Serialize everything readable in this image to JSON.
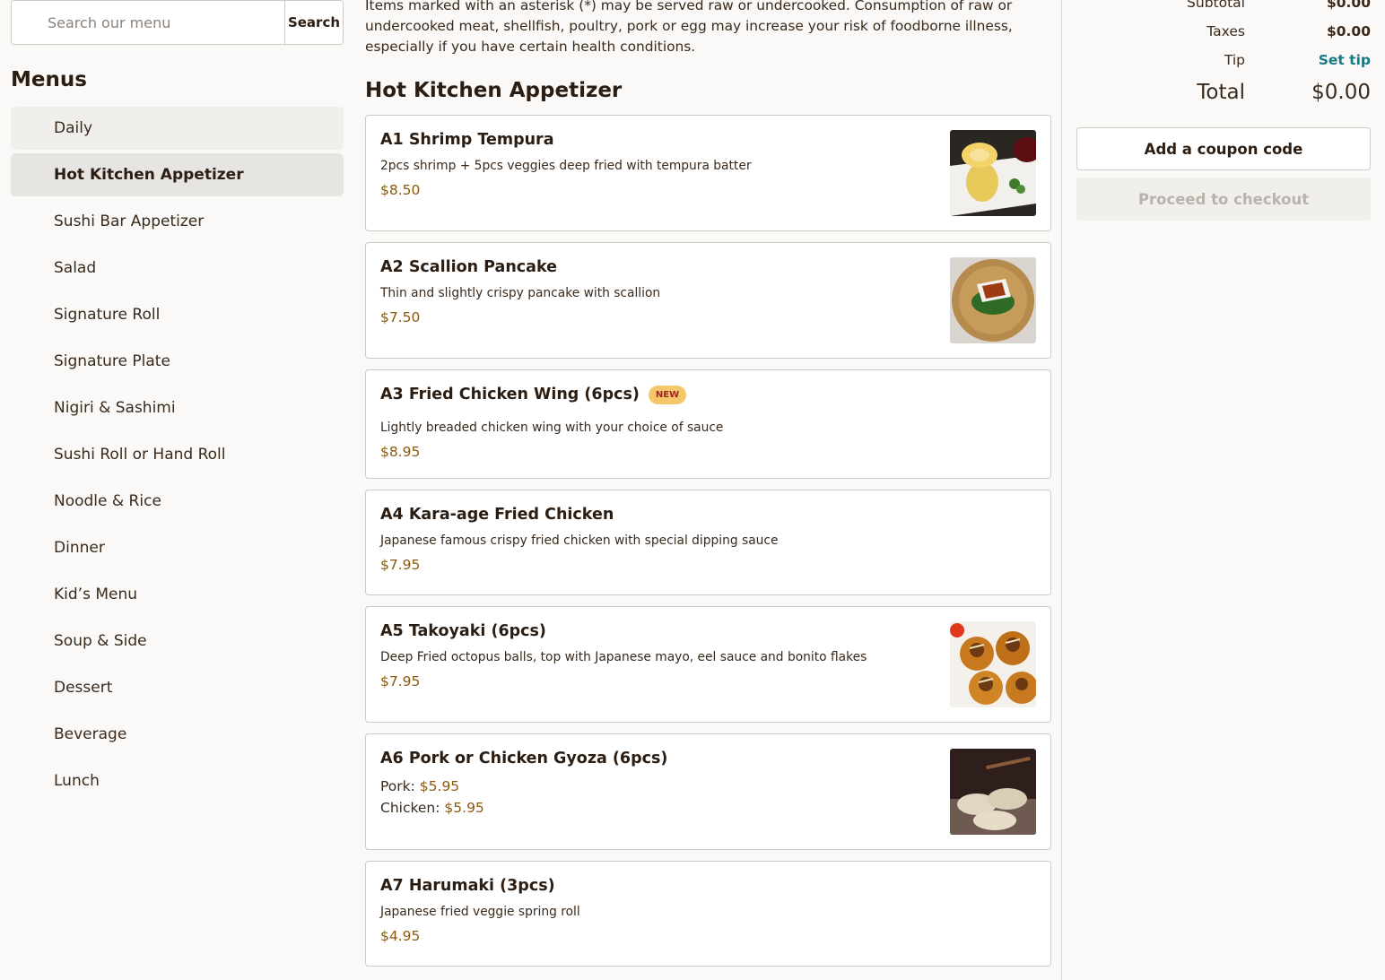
{
  "search": {
    "placeholder": "Search our menu",
    "button_label": "Search"
  },
  "menus": {
    "heading": "Menus",
    "items": [
      {
        "label": "Daily"
      },
      {
        "label": "Hot Kitchen Appetizer"
      },
      {
        "label": "Sushi Bar Appetizer"
      },
      {
        "label": "Salad"
      },
      {
        "label": "Signature Roll"
      },
      {
        "label": "Signature Plate"
      },
      {
        "label": "Nigiri & Sashimi"
      },
      {
        "label": "Sushi Roll or Hand Roll"
      },
      {
        "label": "Noodle & Rice"
      },
      {
        "label": "Dinner"
      },
      {
        "label": "Kid’s Menu"
      },
      {
        "label": "Soup & Side"
      },
      {
        "label": "Dessert"
      },
      {
        "label": "Beverage"
      },
      {
        "label": "Lunch"
      }
    ],
    "active": "Hot Kitchen Appetizer"
  },
  "notice": "Items marked with an asterisk (*) may be served raw or undercooked. Consumption of raw or undercooked meat, shellfish, poultry, pork or egg may increase your risk of foodborne illness, especially if you have certain health conditions.",
  "section": {
    "title": "Hot Kitchen Appetizer",
    "items": [
      {
        "title": "A1 Shrimp Tempura",
        "description": "2pcs shrimp + 5pcs veggies deep fried with tempura batter",
        "price": "$8.50"
      },
      {
        "title": "A2 Scallion Pancake",
        "description": "Thin and slightly crispy pancake with scallion",
        "price": "$7.50"
      },
      {
        "title": "A3 Fried Chicken Wing (6pcs)",
        "badge": "NEW",
        "description": "Lightly breaded chicken wing with your choice of sauce",
        "price": "$8.95"
      },
      {
        "title": "A4 Kara-age Fried Chicken",
        "description": "Japanese famous crispy fried chicken with special dipping sauce",
        "price": "$7.95"
      },
      {
        "title": "A5 Takoyaki (6pcs)",
        "description": "Deep Fried octopus balls, top with Japanese mayo, eel sauce and bonito flakes",
        "price": "$7.95"
      },
      {
        "title": "A6 Pork or Chicken Gyoza (6pcs)",
        "options": [
          {
            "label": "Pork:",
            "price": "$5.95"
          },
          {
            "label": "Chicken:",
            "price": "$5.95"
          }
        ]
      },
      {
        "title": "A7 Harumaki (3pcs)",
        "description": "Japanese fried veggie spring roll",
        "price": "$4.95"
      }
    ]
  },
  "cart": {
    "subtotal_label": "Subtotal",
    "subtotal_value": "$0.00",
    "taxes_label": "Taxes",
    "taxes_value": "$0.00",
    "tip_label": "Tip",
    "tip_link": "Set tip",
    "total_label": "Total",
    "total_value": "$0.00",
    "coupon_button": "Add a coupon code",
    "checkout_button": "Proceed to checkout"
  }
}
